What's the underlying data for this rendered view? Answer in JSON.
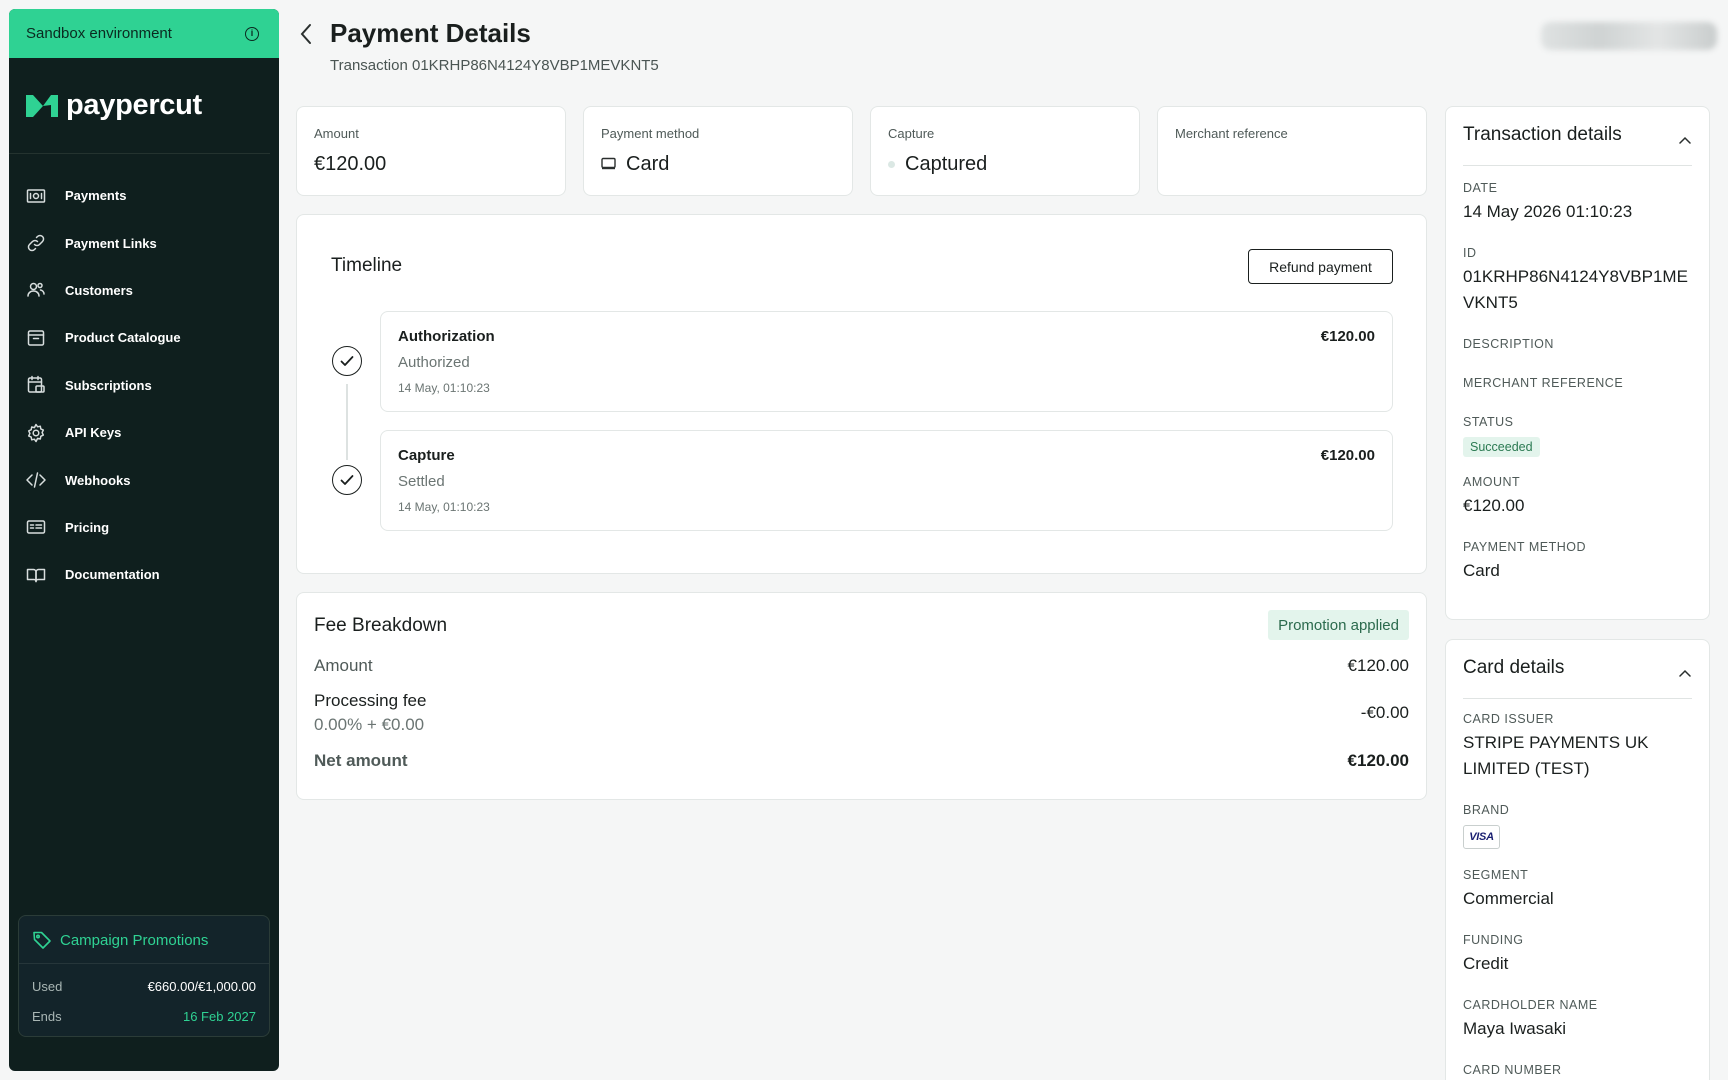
{
  "sidebar": {
    "sandbox_label": "Sandbox environment",
    "logo_text": "paypercut",
    "brand_color": "#2fd293",
    "items": [
      {
        "label": "Payments",
        "icon": "banknote-icon"
      },
      {
        "label": "Payment Links",
        "icon": "link-icon"
      },
      {
        "label": "Customers",
        "icon": "users-icon"
      },
      {
        "label": "Product Catalogue",
        "icon": "archive-icon"
      },
      {
        "label": "Subscriptions",
        "icon": "calendar-card-icon"
      },
      {
        "label": "API Keys",
        "icon": "gear-icon"
      },
      {
        "label": "Webhooks",
        "icon": "code-icon"
      },
      {
        "label": "Pricing",
        "icon": "price-card-icon"
      },
      {
        "label": "Documentation",
        "icon": "book-icon"
      }
    ],
    "promo": {
      "title": "Campaign Promotions",
      "used_label": "Used",
      "used_value": "€660.00/€1,000.00",
      "ends_label": "Ends",
      "ends_value": "16 Feb 2027"
    }
  },
  "header": {
    "title": "Payment Details",
    "subtitle": "Transaction 01KRHP86N4124Y8VBP1MEVKNT5"
  },
  "stats": {
    "amount_label": "Amount",
    "amount_value": "€120.00",
    "method_label": "Payment method",
    "method_value": "Card",
    "capture_label": "Capture",
    "capture_value": "Captured",
    "merchant_label": "Merchant reference",
    "merchant_value": ""
  },
  "timeline": {
    "title": "Timeline",
    "refund_label": "Refund payment",
    "events": [
      {
        "name": "Authorization",
        "status": "Authorized",
        "time": "14 May, 01:10:23",
        "amount": "€120.00"
      },
      {
        "name": "Capture",
        "status": "Settled",
        "time": "14 May, 01:10:23",
        "amount": "€120.00"
      }
    ]
  },
  "fees": {
    "title": "Fee Breakdown",
    "badge": "Promotion applied",
    "amount_label": "Amount",
    "amount_value": "€120.00",
    "processing_label": "Processing fee",
    "processing_sub": "0.00% + €0.00",
    "processing_value": "-€0.00",
    "net_label": "Net amount",
    "net_value": "€120.00"
  },
  "transaction_details": {
    "title": "Transaction details",
    "date_label": "DATE",
    "date_value": "14 May 2026 01:10:23",
    "id_label": "ID",
    "id_value": "01KRHP86N4124Y8VBP1MEVKNT5",
    "description_label": "DESCRIPTION",
    "merchant_ref_label": "MERCHANT REFERENCE",
    "status_label": "STATUS",
    "status_value": "Succeeded",
    "amount_label": "AMOUNT",
    "amount_value": "€120.00",
    "method_label": "PAYMENT METHOD",
    "method_value": "Card"
  },
  "card_details": {
    "title": "Card details",
    "issuer_label": "CARD ISSUER",
    "issuer_value": "STRIPE PAYMENTS UK LIMITED (TEST)",
    "brand_label": "BRAND",
    "brand_value": "VISA",
    "segment_label": "SEGMENT",
    "segment_value": "Commercial",
    "funding_label": "FUNDING",
    "funding_value": "Credit",
    "holder_label": "CARDHOLDER NAME",
    "holder_value": "Maya Iwasaki",
    "number_label": "CARD NUMBER"
  }
}
